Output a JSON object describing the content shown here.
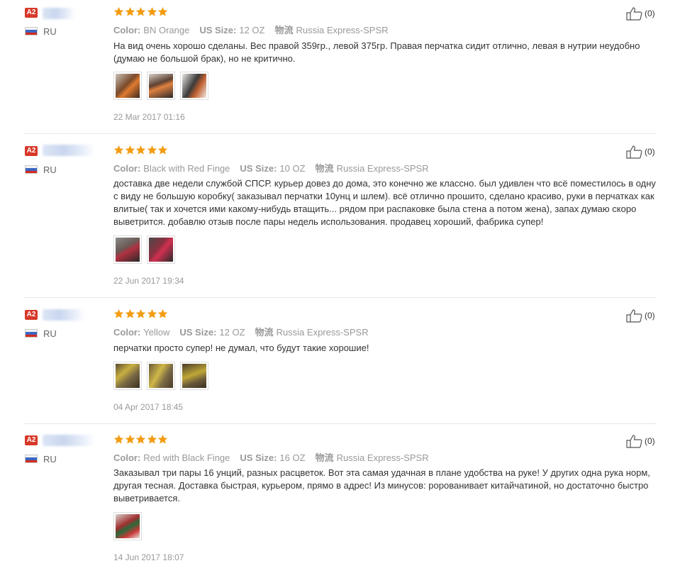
{
  "reviews": [
    {
      "badge": "A2",
      "country": "RU",
      "color_label": "Color:",
      "color": "BN Orange",
      "size_label": "US Size:",
      "size": "12 OZ",
      "ship_label": "物流",
      "shipping": "Russia Express-SPSR",
      "text": "На вид очень хорошо сделаны. Вес правой 359гр., левой 375гр. Правая перчатка сидит отлично, левая в нутрии неудобно (думаю не большой брак), но не критично.",
      "date": "22 Mar 2017 01:16",
      "helpful": "(0)",
      "rating": 5,
      "photos": [
        "#7a4a2a",
        "#5d4030",
        "#3a3a3a"
      ]
    },
    {
      "badge": "A2",
      "country": "RU",
      "color_label": "Color:",
      "color": "Black with Red Finge",
      "size_label": "US Size:",
      "size": "10 OZ",
      "ship_label": "物流",
      "shipping": "Russia Express-SPSR",
      "text": "доставка две недели службой СПСР. курьер довез до дома, это конечно же классно. был удивлен что всё поместилось в одну с виду не большую коробку( заказывал перчатки 10унц и шлем). всё отлично прошито, сделано красиво, руки в перчатках как влитые( так и хочется ими какому-нибудь втащить... рядом при распаковке была стена а потом жена), запах думаю скоро выветрится. добавлю отзыв после пары недель использования. продавец хороший, фабрика супер!",
      "date": "22 Jun 2017 19:34",
      "helpful": "(0)",
      "rating": 5,
      "photos": [
        "#6a5a55",
        "#8a3040"
      ]
    },
    {
      "badge": "A2",
      "country": "RU",
      "color_label": "Color:",
      "color": "Yellow",
      "size_label": "US Size:",
      "size": "12 OZ",
      "ship_label": "物流",
      "shipping": "Russia Express-SPSR",
      "text": "перчатки просто супер! не думал, что будут такие хорошие!",
      "date": "04 Apr 2017 18:45",
      "helpful": "(0)",
      "rating": 5,
      "photos": [
        "#8a7a40",
        "#7a6a45",
        "#6a5a3a"
      ]
    },
    {
      "badge": "A2",
      "country": "RU",
      "color_label": "Color:",
      "color": "Red with Black Finge",
      "size_label": "US Size:",
      "size": "16 OZ",
      "ship_label": "物流",
      "shipping": "Russia Express-SPSR",
      "text": "Заказывал три пары 16 унций, разных расцветок. Вот эта самая удачная в плане удобства на руке! У других одна рука норм, другая тесная. Доставка быстрая, курьером, прямо в адрес! Из минусов: popованивает китайчатиной, но достаточно быстро выветривается.",
      "date": "14 Jun 2017 18:07",
      "helpful": "(0)",
      "rating": 5,
      "photos": [
        "#a03030"
      ]
    }
  ]
}
